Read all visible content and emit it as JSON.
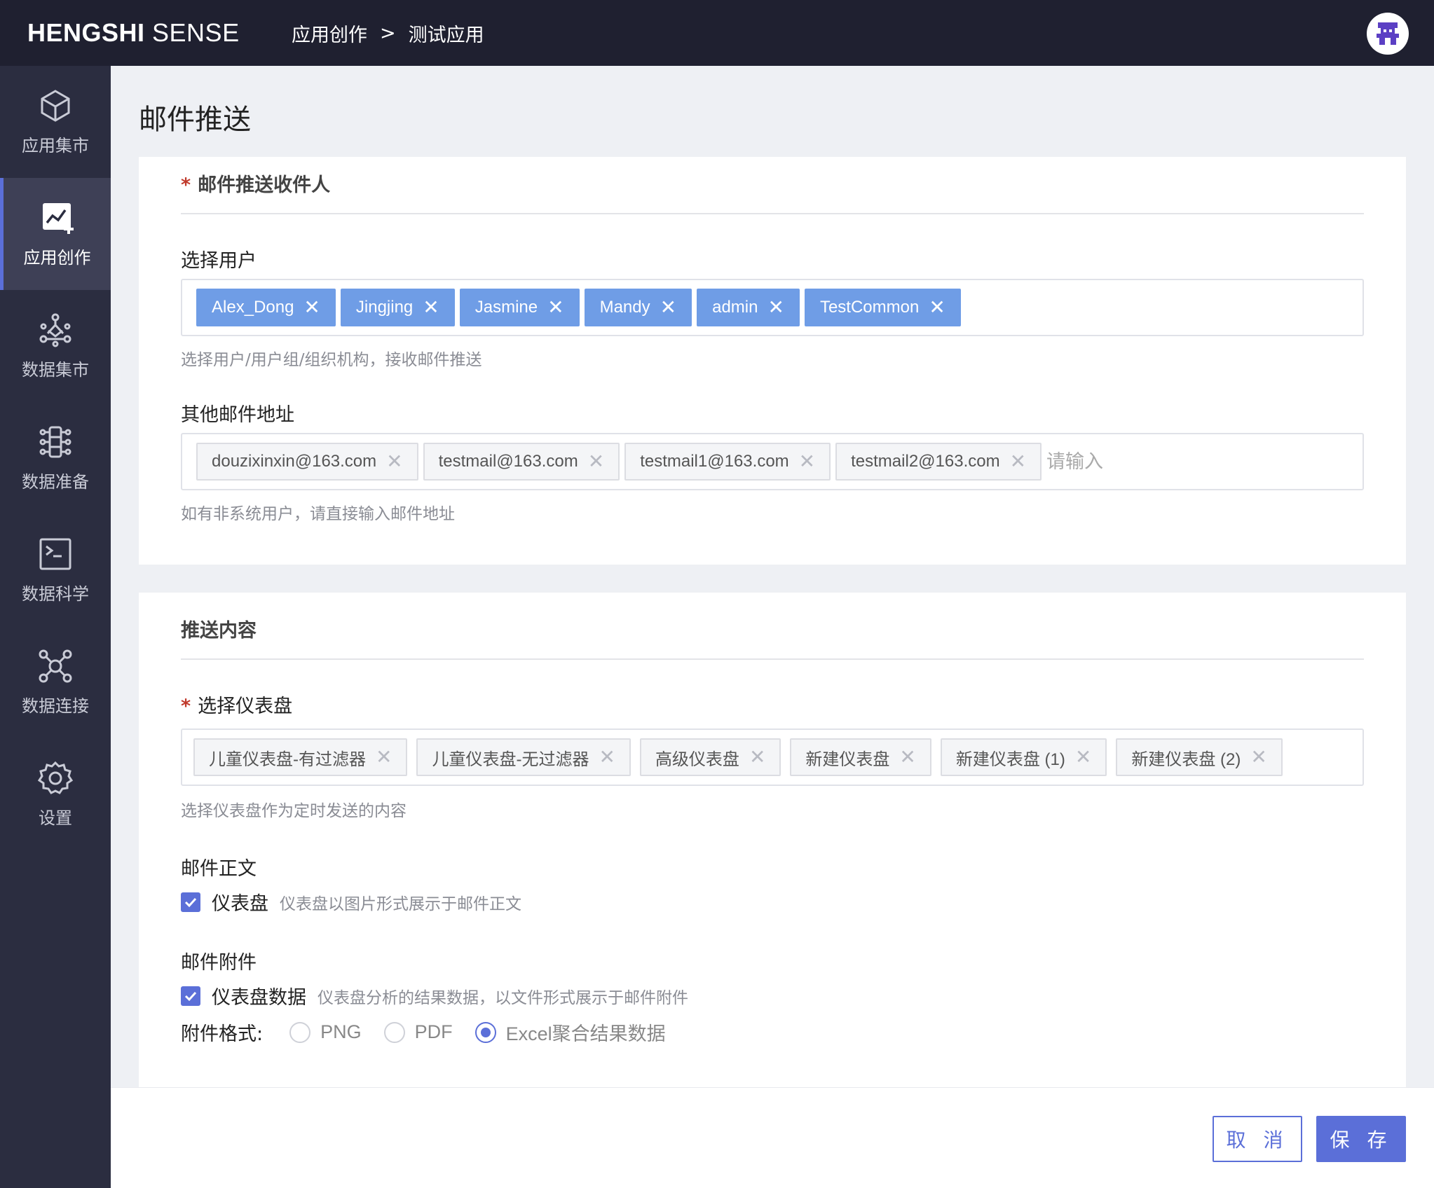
{
  "header": {
    "logo_bold": "HENGSHI",
    "logo_light": " SENSE",
    "breadcrumb": [
      "应用创作",
      ">",
      "测试应用"
    ]
  },
  "sidebar": {
    "items": [
      {
        "label": "应用集市",
        "icon": "cube-icon",
        "active": false
      },
      {
        "label": "应用创作",
        "icon": "chart-edit-icon",
        "active": true
      },
      {
        "label": "数据集市",
        "icon": "network-icon",
        "active": false
      },
      {
        "label": "数据准备",
        "icon": "data-prep-icon",
        "active": false
      },
      {
        "label": "数据科学",
        "icon": "terminal-icon",
        "active": false
      },
      {
        "label": "数据连接",
        "icon": "connection-icon",
        "active": false
      },
      {
        "label": "设置",
        "icon": "gear-icon",
        "active": false
      }
    ]
  },
  "page": {
    "title": "邮件推送"
  },
  "recipients": {
    "section_title": "邮件推送收件人",
    "required_mark": "*",
    "users_label": "选择用户",
    "users": [
      "Alex_Dong",
      "Jingjing",
      "Jasmine",
      "Mandy",
      "admin",
      "TestCommon"
    ],
    "users_hint": "选择用户/用户组/组织机构，接收邮件推送",
    "emails_label": "其他邮件地址",
    "emails": [
      "douzixinxin@163.com",
      "testmail@163.com",
      "testmail1@163.com",
      "testmail2@163.com"
    ],
    "emails_placeholder": "请输入",
    "emails_hint": "如有非系统用户，请直接输入邮件地址"
  },
  "content": {
    "section_title": "推送内容",
    "dashboard_label": "选择仪表盘",
    "required_mark": "*",
    "dashboards": [
      "儿童仪表盘-有过滤器",
      "儿童仪表盘-无过滤器",
      "高级仪表盘",
      "新建仪表盘",
      "新建仪表盘 (1)",
      "新建仪表盘 (2)"
    ],
    "dashboard_hint": "选择仪表盘作为定时发送的内容",
    "body_label": "邮件正文",
    "body_check_label": "仪表盘",
    "body_check_hint": "仪表盘以图片形式展示于邮件正文",
    "body_checked": true,
    "attach_label": "邮件附件",
    "attach_check_label": "仪表盘数据",
    "attach_check_hint": "仪表盘分析的结果数据，以文件形式展示于邮件附件",
    "attach_checked": true,
    "format_label": "附件格式:",
    "formats": [
      "PNG",
      "PDF",
      "Excel聚合结果数据"
    ],
    "selected_format": "Excel聚合结果数据"
  },
  "footer": {
    "cancel_label": "取 消",
    "save_label": "保 存"
  },
  "colors": {
    "accent": "#5b6fd8",
    "topbar": "#1f2030",
    "sidebar": "#2b2d40",
    "user_tag": "#6f9de6"
  }
}
